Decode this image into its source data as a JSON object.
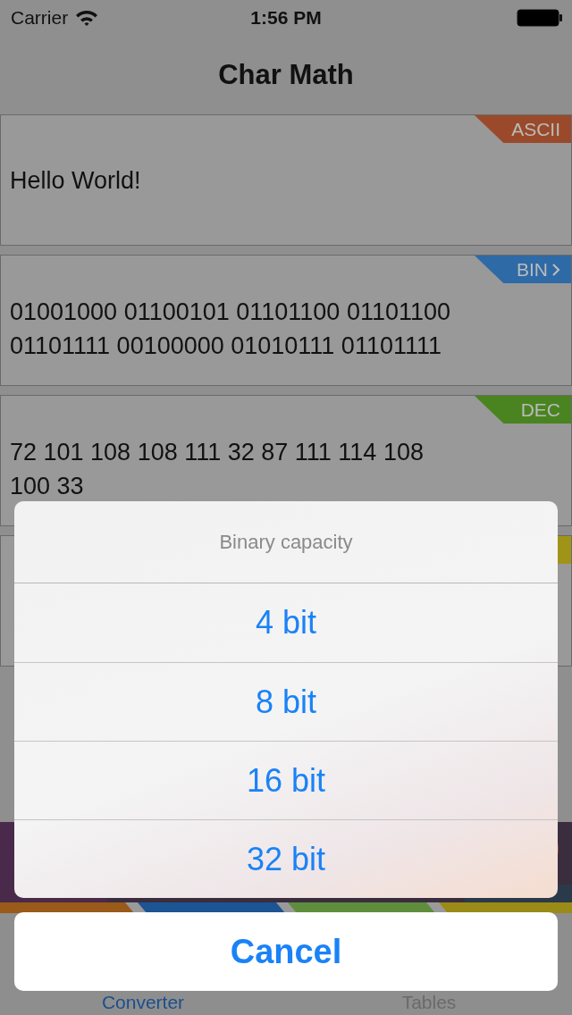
{
  "status_bar": {
    "carrier": "Carrier",
    "time": "1:56 PM"
  },
  "nav_bar": {
    "title": "Char Math"
  },
  "fields": [
    {
      "tag": "ASCII",
      "color": "#9a4a2a",
      "chevron": false,
      "lines": [
        "Hello World!"
      ]
    },
    {
      "tag": "BIN",
      "color": "#2e6aa6",
      "chevron": true,
      "lines": [
        "01001000 01100101 01101100 01101100",
        "01101111 00100000 01010111 01101111"
      ]
    },
    {
      "tag": "DEC",
      "color": "#4a8420",
      "chevron": false,
      "lines": [
        "72 101 108 108 111 32 87 111 114 108",
        "100 33"
      ]
    },
    {
      "color": "#a09418",
      "chevron": false
    }
  ],
  "section_strip": [
    {
      "color": "#9a5a1a"
    },
    {
      "color": "#1c5494"
    },
    {
      "color": "#5e8e3c"
    },
    {
      "color": "#9a8a18"
    }
  ],
  "tab_bar": [
    {
      "label": "Converter",
      "selected": true
    },
    {
      "label": "Tables",
      "selected": false
    }
  ],
  "action_sheet": {
    "title": "Binary capacity",
    "options": [
      "4 bit",
      "8 bit",
      "16 bit",
      "32 bit"
    ],
    "cancel": "Cancel"
  }
}
